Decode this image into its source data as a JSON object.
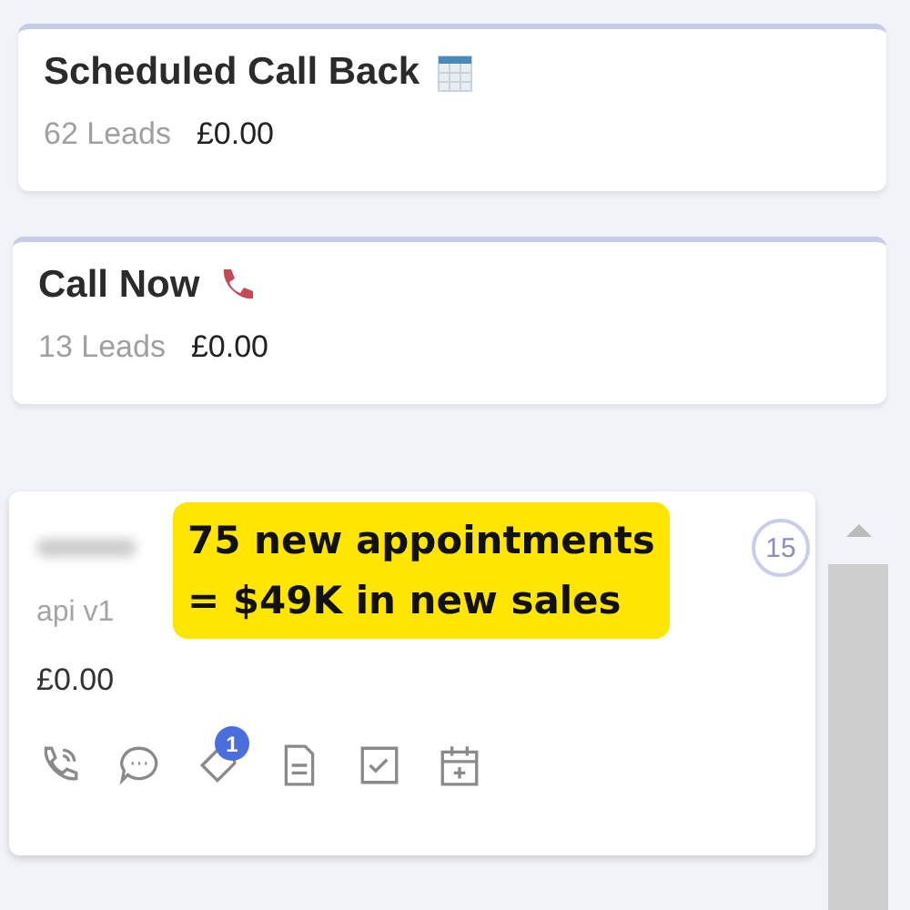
{
  "stages": [
    {
      "title": "Scheduled Call Back",
      "kind": "calendar",
      "leads": "62 Leads",
      "amount": "£0.00"
    },
    {
      "title": "Call Now",
      "kind": "phone",
      "leads": "13 Leads",
      "amount": "£0.00"
    }
  ],
  "lead_card": {
    "count_badge": "15",
    "source": "api v1",
    "amount": "£0.00",
    "actions": [
      {
        "kind": "phone"
      },
      {
        "kind": "chat"
      },
      {
        "kind": "tag",
        "badge": "1"
      },
      {
        "kind": "note"
      },
      {
        "kind": "task"
      },
      {
        "kind": "calendar-plus"
      }
    ]
  },
  "callout": {
    "lines": [
      "75 new appointments",
      "= $49K in new sales"
    ]
  }
}
